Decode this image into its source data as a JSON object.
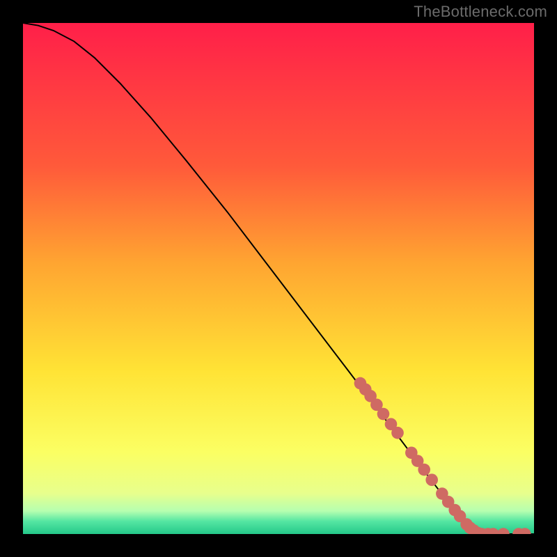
{
  "watermark": "TheBottleneck.com",
  "chart_data": {
    "type": "line",
    "title": "",
    "xlabel": "",
    "ylabel": "",
    "xlim": [
      0,
      100
    ],
    "ylim": [
      0,
      100
    ],
    "background_gradient": {
      "stops": [
        {
          "offset": 0.0,
          "color": "#ff1f49"
        },
        {
          "offset": 0.28,
          "color": "#ff5a3a"
        },
        {
          "offset": 0.47,
          "color": "#ffa531"
        },
        {
          "offset": 0.68,
          "color": "#ffe335"
        },
        {
          "offset": 0.84,
          "color": "#fbff63"
        },
        {
          "offset": 0.92,
          "color": "#e8ff8c"
        },
        {
          "offset": 0.955,
          "color": "#b6ffb0"
        },
        {
          "offset": 0.975,
          "color": "#55e6a2"
        },
        {
          "offset": 1.0,
          "color": "#24c98a"
        }
      ]
    },
    "curve": {
      "name": "bottleneck-curve",
      "color": "#000000",
      "points": [
        {
          "x": 0,
          "y": 100.0
        },
        {
          "x": 3,
          "y": 99.5
        },
        {
          "x": 6,
          "y": 98.5
        },
        {
          "x": 10,
          "y": 96.4
        },
        {
          "x": 14,
          "y": 93.2
        },
        {
          "x": 19,
          "y": 88.2
        },
        {
          "x": 25,
          "y": 81.5
        },
        {
          "x": 32,
          "y": 73.0
        },
        {
          "x": 40,
          "y": 63.0
        },
        {
          "x": 48,
          "y": 52.5
        },
        {
          "x": 56,
          "y": 42.0
        },
        {
          "x": 64,
          "y": 31.5
        },
        {
          "x": 72,
          "y": 21.0
        },
        {
          "x": 78,
          "y": 13.0
        },
        {
          "x": 83,
          "y": 6.5
        },
        {
          "x": 86,
          "y": 2.8
        },
        {
          "x": 88,
          "y": 1.0
        },
        {
          "x": 90,
          "y": 0.2
        },
        {
          "x": 93,
          "y": 0.0
        },
        {
          "x": 100,
          "y": 0.0
        }
      ]
    },
    "markers": {
      "color": "#cf6a63",
      "radius_ratio": 0.012,
      "points": [
        {
          "x": 66.0,
          "y": 29.5
        },
        {
          "x": 67.0,
          "y": 28.3
        },
        {
          "x": 68.0,
          "y": 27.0
        },
        {
          "x": 69.2,
          "y": 25.3
        },
        {
          "x": 70.5,
          "y": 23.5
        },
        {
          "x": 72.0,
          "y": 21.5
        },
        {
          "x": 73.3,
          "y": 19.8
        },
        {
          "x": 76.0,
          "y": 15.9
        },
        {
          "x": 77.2,
          "y": 14.3
        },
        {
          "x": 78.5,
          "y": 12.6
        },
        {
          "x": 80.0,
          "y": 10.6
        },
        {
          "x": 82.0,
          "y": 7.9
        },
        {
          "x": 83.2,
          "y": 6.3
        },
        {
          "x": 84.5,
          "y": 4.7
        },
        {
          "x": 85.5,
          "y": 3.5
        },
        {
          "x": 86.8,
          "y": 1.9
        },
        {
          "x": 87.5,
          "y": 1.2
        },
        {
          "x": 88.2,
          "y": 0.7
        },
        {
          "x": 89.0,
          "y": 0.2
        },
        {
          "x": 89.8,
          "y": 0.0
        },
        {
          "x": 91.0,
          "y": 0.0
        },
        {
          "x": 92.0,
          "y": 0.0
        },
        {
          "x": 94.0,
          "y": 0.0
        },
        {
          "x": 97.0,
          "y": 0.0
        },
        {
          "x": 98.2,
          "y": 0.0
        }
      ]
    }
  }
}
